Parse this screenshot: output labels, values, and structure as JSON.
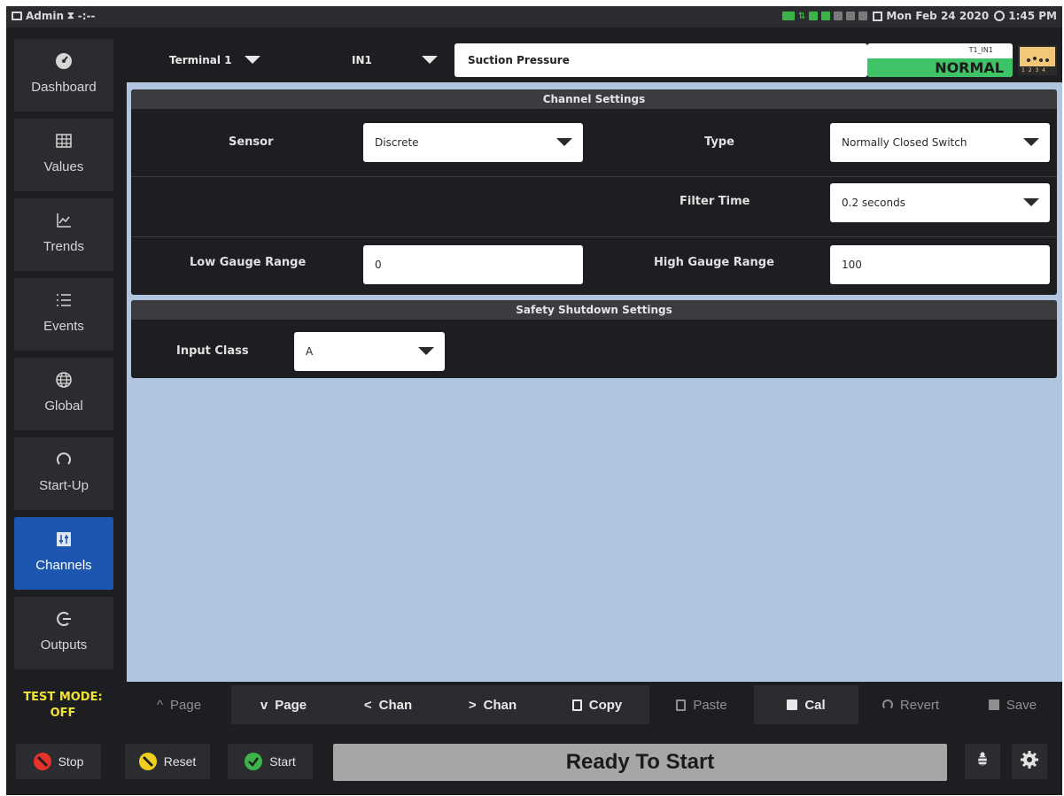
{
  "status_bar": {
    "user": "Admin",
    "user_extra": "-:--",
    "date": "Mon Feb 24 2020",
    "time": "1:45 PM"
  },
  "sidebar": {
    "items": [
      {
        "label": "Dashboard",
        "icon": "gauge-icon"
      },
      {
        "label": "Values",
        "icon": "grid-icon"
      },
      {
        "label": "Trends",
        "icon": "trend-chart-icon"
      },
      {
        "label": "Events",
        "icon": "list-icon"
      },
      {
        "label": "Global",
        "icon": "globe-icon"
      },
      {
        "label": "Start-Up",
        "icon": "restart-icon"
      },
      {
        "label": "Channels",
        "icon": "sliders-icon",
        "active": true
      },
      {
        "label": "Outputs",
        "icon": "output-icon"
      }
    ],
    "test_mode_label": "TEST MODE:",
    "test_mode_value": "OFF"
  },
  "topbar": {
    "terminal": "Terminal 1",
    "input": "IN1",
    "channel_name": "Suction Pressure",
    "status_tag": "T1_IN1",
    "status_state": "NORMAL",
    "gauge_digits": "1 2 3 4"
  },
  "channel_settings": {
    "title": "Channel Settings",
    "sensor_label": "Sensor",
    "sensor_value": "Discrete",
    "type_label": "Type",
    "type_value": "Normally Closed Switch",
    "filter_time_label": "Filter Time",
    "filter_time_value": "0.2 seconds",
    "low_gauge_label": "Low Gauge Range",
    "low_gauge_value": "0",
    "high_gauge_label": "High Gauge Range",
    "high_gauge_value": "100"
  },
  "safety_settings": {
    "title": "Safety Shutdown Settings",
    "input_class_label": "Input Class",
    "input_class_value": "A"
  },
  "action_bar": {
    "page_up": "Page",
    "page_down": "Page",
    "chan_prev": "Chan",
    "chan_next": "Chan",
    "copy": "Copy",
    "paste": "Paste",
    "cal": "Cal",
    "revert": "Revert",
    "save": "Save"
  },
  "bottom_bar": {
    "stop": "Stop",
    "reset": "Reset",
    "start": "Start",
    "status": "Ready To Start"
  },
  "colors": {
    "accent": "#1d56b0",
    "normal_status": "#3ec466",
    "test_mode": "#f1e23a",
    "content_bg": "#b1c5df",
    "stop": "#e5332a",
    "reset": "#f2cf1d",
    "start": "#3cb44a"
  }
}
